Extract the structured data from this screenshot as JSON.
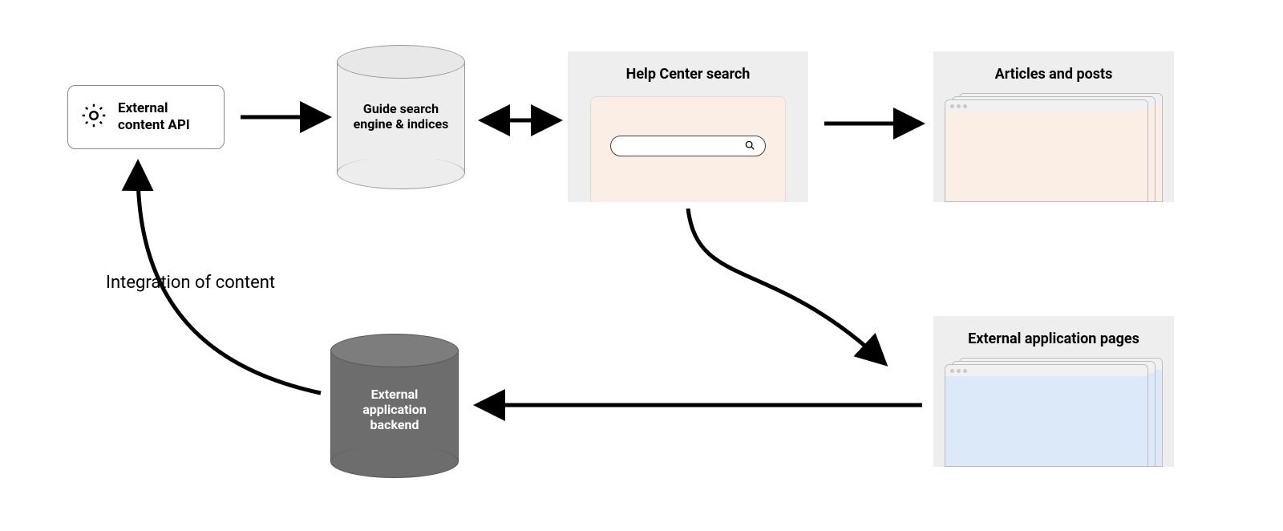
{
  "nodes": {
    "api": {
      "label": "External\ncontent API"
    },
    "guide_db": {
      "label": "Guide search\nengine & indices"
    },
    "help_center": {
      "title": "Help Center search"
    },
    "articles": {
      "title": "Articles and posts"
    },
    "ext_backend": {
      "label": "External\napplication\nbackend"
    },
    "ext_pages": {
      "title": "External application pages"
    }
  },
  "edges": {
    "integration_label": "Integration\nof content"
  },
  "icons": {
    "gear": "gear-icon",
    "search": "search-icon"
  }
}
